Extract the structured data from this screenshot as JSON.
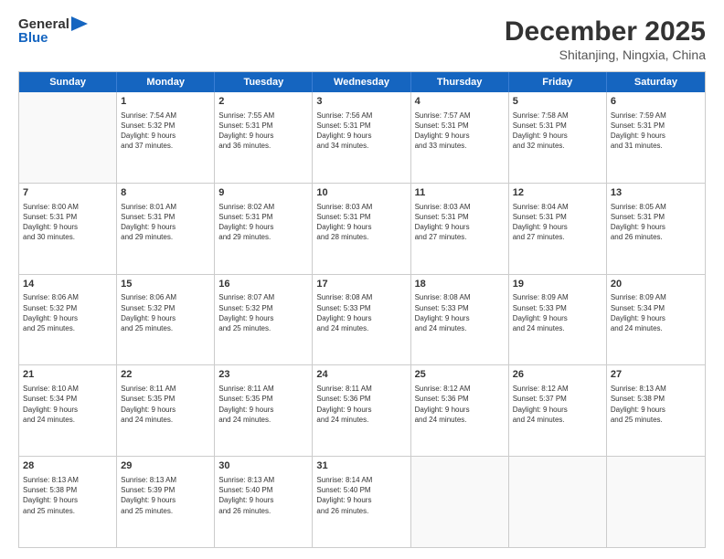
{
  "header": {
    "logo_general": "General",
    "logo_blue": "Blue",
    "month_title": "December 2025",
    "subtitle": "Shitanjing, Ningxia, China"
  },
  "calendar": {
    "days_of_week": [
      "Sunday",
      "Monday",
      "Tuesday",
      "Wednesday",
      "Thursday",
      "Friday",
      "Saturday"
    ],
    "weeks": [
      [
        {
          "day": "",
          "lines": [],
          "empty": true
        },
        {
          "day": "1",
          "lines": [
            "Sunrise: 7:54 AM",
            "Sunset: 5:32 PM",
            "Daylight: 9 hours",
            "and 37 minutes."
          ],
          "empty": false
        },
        {
          "day": "2",
          "lines": [
            "Sunrise: 7:55 AM",
            "Sunset: 5:31 PM",
            "Daylight: 9 hours",
            "and 36 minutes."
          ],
          "empty": false
        },
        {
          "day": "3",
          "lines": [
            "Sunrise: 7:56 AM",
            "Sunset: 5:31 PM",
            "Daylight: 9 hours",
            "and 34 minutes."
          ],
          "empty": false
        },
        {
          "day": "4",
          "lines": [
            "Sunrise: 7:57 AM",
            "Sunset: 5:31 PM",
            "Daylight: 9 hours",
            "and 33 minutes."
          ],
          "empty": false
        },
        {
          "day": "5",
          "lines": [
            "Sunrise: 7:58 AM",
            "Sunset: 5:31 PM",
            "Daylight: 9 hours",
            "and 32 minutes."
          ],
          "empty": false
        },
        {
          "day": "6",
          "lines": [
            "Sunrise: 7:59 AM",
            "Sunset: 5:31 PM",
            "Daylight: 9 hours",
            "and 31 minutes."
          ],
          "empty": false
        }
      ],
      [
        {
          "day": "7",
          "lines": [
            "Sunrise: 8:00 AM",
            "Sunset: 5:31 PM",
            "Daylight: 9 hours",
            "and 30 minutes."
          ],
          "empty": false
        },
        {
          "day": "8",
          "lines": [
            "Sunrise: 8:01 AM",
            "Sunset: 5:31 PM",
            "Daylight: 9 hours",
            "and 29 minutes."
          ],
          "empty": false
        },
        {
          "day": "9",
          "lines": [
            "Sunrise: 8:02 AM",
            "Sunset: 5:31 PM",
            "Daylight: 9 hours",
            "and 29 minutes."
          ],
          "empty": false
        },
        {
          "day": "10",
          "lines": [
            "Sunrise: 8:03 AM",
            "Sunset: 5:31 PM",
            "Daylight: 9 hours",
            "and 28 minutes."
          ],
          "empty": false
        },
        {
          "day": "11",
          "lines": [
            "Sunrise: 8:03 AM",
            "Sunset: 5:31 PM",
            "Daylight: 9 hours",
            "and 27 minutes."
          ],
          "empty": false
        },
        {
          "day": "12",
          "lines": [
            "Sunrise: 8:04 AM",
            "Sunset: 5:31 PM",
            "Daylight: 9 hours",
            "and 27 minutes."
          ],
          "empty": false
        },
        {
          "day": "13",
          "lines": [
            "Sunrise: 8:05 AM",
            "Sunset: 5:31 PM",
            "Daylight: 9 hours",
            "and 26 minutes."
          ],
          "empty": false
        }
      ],
      [
        {
          "day": "14",
          "lines": [
            "Sunrise: 8:06 AM",
            "Sunset: 5:32 PM",
            "Daylight: 9 hours",
            "and 25 minutes."
          ],
          "empty": false
        },
        {
          "day": "15",
          "lines": [
            "Sunrise: 8:06 AM",
            "Sunset: 5:32 PM",
            "Daylight: 9 hours",
            "and 25 minutes."
          ],
          "empty": false
        },
        {
          "day": "16",
          "lines": [
            "Sunrise: 8:07 AM",
            "Sunset: 5:32 PM",
            "Daylight: 9 hours",
            "and 25 minutes."
          ],
          "empty": false
        },
        {
          "day": "17",
          "lines": [
            "Sunrise: 8:08 AM",
            "Sunset: 5:33 PM",
            "Daylight: 9 hours",
            "and 24 minutes."
          ],
          "empty": false
        },
        {
          "day": "18",
          "lines": [
            "Sunrise: 8:08 AM",
            "Sunset: 5:33 PM",
            "Daylight: 9 hours",
            "and 24 minutes."
          ],
          "empty": false
        },
        {
          "day": "19",
          "lines": [
            "Sunrise: 8:09 AM",
            "Sunset: 5:33 PM",
            "Daylight: 9 hours",
            "and 24 minutes."
          ],
          "empty": false
        },
        {
          "day": "20",
          "lines": [
            "Sunrise: 8:09 AM",
            "Sunset: 5:34 PM",
            "Daylight: 9 hours",
            "and 24 minutes."
          ],
          "empty": false
        }
      ],
      [
        {
          "day": "21",
          "lines": [
            "Sunrise: 8:10 AM",
            "Sunset: 5:34 PM",
            "Daylight: 9 hours",
            "and 24 minutes."
          ],
          "empty": false
        },
        {
          "day": "22",
          "lines": [
            "Sunrise: 8:11 AM",
            "Sunset: 5:35 PM",
            "Daylight: 9 hours",
            "and 24 minutes."
          ],
          "empty": false
        },
        {
          "day": "23",
          "lines": [
            "Sunrise: 8:11 AM",
            "Sunset: 5:35 PM",
            "Daylight: 9 hours",
            "and 24 minutes."
          ],
          "empty": false
        },
        {
          "day": "24",
          "lines": [
            "Sunrise: 8:11 AM",
            "Sunset: 5:36 PM",
            "Daylight: 9 hours",
            "and 24 minutes."
          ],
          "empty": false
        },
        {
          "day": "25",
          "lines": [
            "Sunrise: 8:12 AM",
            "Sunset: 5:36 PM",
            "Daylight: 9 hours",
            "and 24 minutes."
          ],
          "empty": false
        },
        {
          "day": "26",
          "lines": [
            "Sunrise: 8:12 AM",
            "Sunset: 5:37 PM",
            "Daylight: 9 hours",
            "and 24 minutes."
          ],
          "empty": false
        },
        {
          "day": "27",
          "lines": [
            "Sunrise: 8:13 AM",
            "Sunset: 5:38 PM",
            "Daylight: 9 hours",
            "and 25 minutes."
          ],
          "empty": false
        }
      ],
      [
        {
          "day": "28",
          "lines": [
            "Sunrise: 8:13 AM",
            "Sunset: 5:38 PM",
            "Daylight: 9 hours",
            "and 25 minutes."
          ],
          "empty": false
        },
        {
          "day": "29",
          "lines": [
            "Sunrise: 8:13 AM",
            "Sunset: 5:39 PM",
            "Daylight: 9 hours",
            "and 25 minutes."
          ],
          "empty": false
        },
        {
          "day": "30",
          "lines": [
            "Sunrise: 8:13 AM",
            "Sunset: 5:40 PM",
            "Daylight: 9 hours",
            "and 26 minutes."
          ],
          "empty": false
        },
        {
          "day": "31",
          "lines": [
            "Sunrise: 8:14 AM",
            "Sunset: 5:40 PM",
            "Daylight: 9 hours",
            "and 26 minutes."
          ],
          "empty": false
        },
        {
          "day": "",
          "lines": [],
          "empty": true
        },
        {
          "day": "",
          "lines": [],
          "empty": true
        },
        {
          "day": "",
          "lines": [],
          "empty": true
        }
      ]
    ]
  }
}
